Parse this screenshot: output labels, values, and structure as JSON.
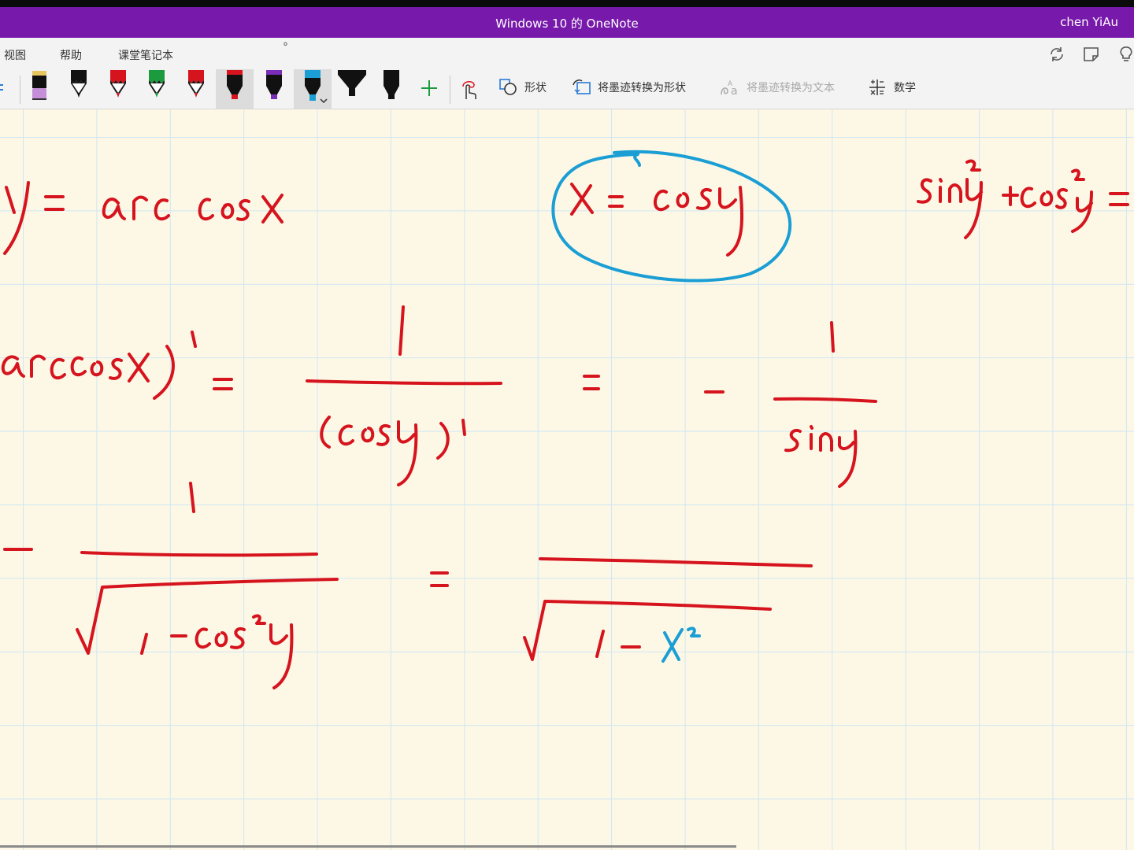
{
  "window": {
    "title": "Windows 10 的 OneNote",
    "user": "chen YiAu"
  },
  "menu": {
    "items": [
      "视图",
      "帮助",
      "课堂笔记本"
    ]
  },
  "toolbar": {
    "shapes_label": "形状",
    "ink_to_shape_label": "将墨迹转换为形状",
    "ink_to_text_label": "将墨迹转换为文本",
    "math_label": "数学"
  },
  "colors": {
    "title_bar": "#7719aa",
    "ink_red": "#d6141e",
    "ink_blue": "#1a9ed4",
    "page_bg": "#fdf8e6",
    "grid": "#cfe6f3"
  }
}
